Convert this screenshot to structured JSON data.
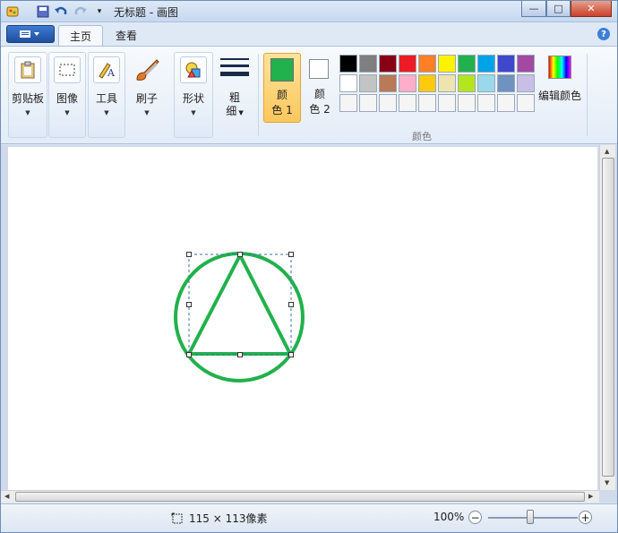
{
  "window": {
    "title": "无标题 - 画图",
    "controls": {
      "minimize": "—",
      "maximize": "□",
      "close": "✕"
    }
  },
  "tabs": {
    "home": "主页",
    "view": "查看"
  },
  "ribbon": {
    "clipboard": "剪贴板",
    "image": "图像",
    "tools": "工具",
    "brushes": "刷子",
    "shapes": "形状",
    "size_line1": "粗",
    "size_line2": "细",
    "color1_line1": "颜",
    "color1_line2": "色 1",
    "color2_line1": "颜",
    "color2_line2": "色 2",
    "edit_colors": "编辑颜色",
    "colors_group": "颜色"
  },
  "palette": {
    "row1": [
      "#000000",
      "#7f7f7f",
      "#880015",
      "#ed1c24",
      "#ff7f27",
      "#fff200",
      "#22b14c",
      "#00a2e8",
      "#3f48cc",
      "#a349a4"
    ],
    "row2": [
      "#ffffff",
      "#c3c3c3",
      "#b97a57",
      "#ffaec9",
      "#ffc90e",
      "#efe4b0",
      "#b5e61d",
      "#99d9ea",
      "#7092be",
      "#c8bfe7"
    ],
    "row3": [
      "#f5f5f5",
      "#f5f5f5",
      "#f5f5f5",
      "#f5f5f5",
      "#f5f5f5",
      "#f5f5f5",
      "#f5f5f5",
      "#f5f5f5",
      "#f5f5f5",
      "#f5f5f5"
    ]
  },
  "accent": {
    "color1": "#22b14c",
    "color2": "#ffffff",
    "drawing_stroke": "#22b14c"
  },
  "status": {
    "selection_size": "115 × 113像素",
    "zoom": "100%"
  },
  "icons": [
    "save-icon",
    "undo-icon",
    "redo-icon",
    "clipboard-icon",
    "select-icon",
    "tools-icon",
    "brush-icon",
    "shapes-icon",
    "size-icon",
    "help-icon",
    "selection-size-icon",
    "zoom-out-icon",
    "zoom-in-icon"
  ]
}
